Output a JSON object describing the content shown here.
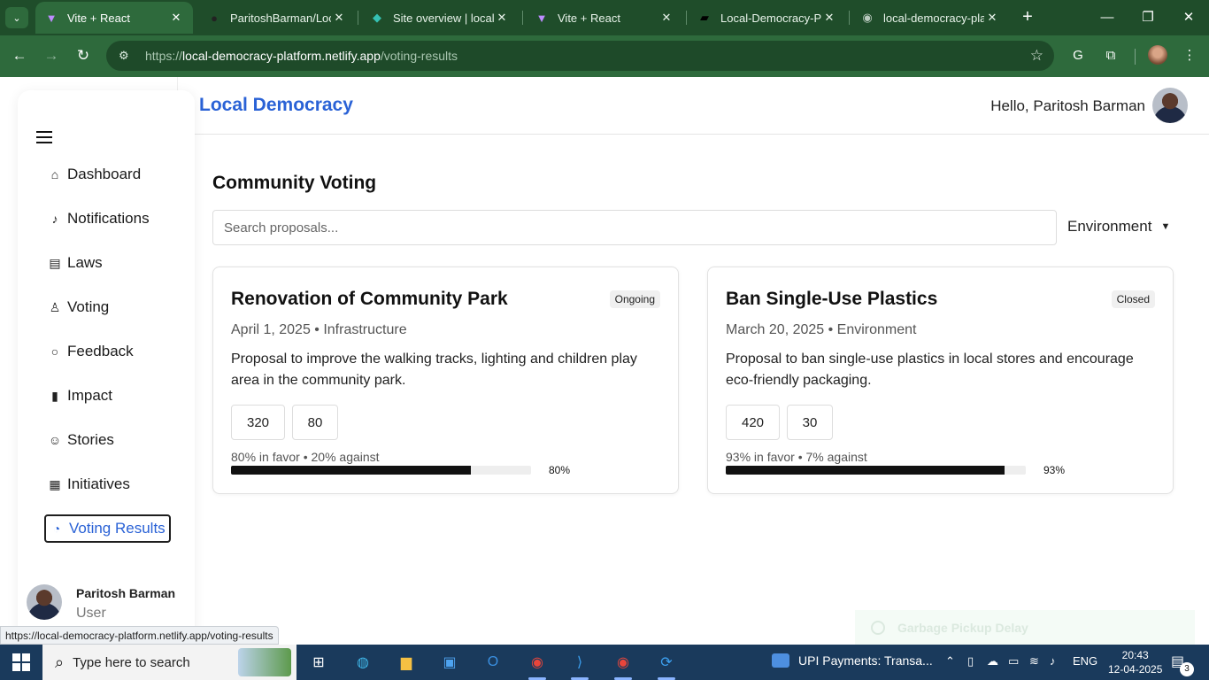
{
  "browser": {
    "tabs": [
      {
        "title": "Vite + React",
        "icon": "vite-icon",
        "active": true
      },
      {
        "title": "ParitoshBarman/Local",
        "icon": "github-icon"
      },
      {
        "title": "Site overview | local-d",
        "icon": "netlify-icon"
      },
      {
        "title": "Vite + React",
        "icon": "vite-icon"
      },
      {
        "title": "Local-Democracy-Pla",
        "icon": "vercel-icon"
      },
      {
        "title": "local-democracy-platf",
        "icon": "globe-icon"
      }
    ],
    "url_scheme": "https://",
    "url_host": "local-democracy-platform.netlify.app",
    "url_path": "/voting-results",
    "status_url": "https://local-democracy-platform.netlify.app/voting-results"
  },
  "header": {
    "brand": "Local Democracy",
    "greeting": "Hello, Paritosh Barman"
  },
  "sidebar": {
    "items": [
      {
        "label": "Dashboard",
        "icon": "home-icon"
      },
      {
        "label": "Notifications",
        "icon": "bell-icon"
      },
      {
        "label": "Laws",
        "icon": "document-icon"
      },
      {
        "label": "Voting",
        "icon": "thumbs-up-icon"
      },
      {
        "label": "Feedback",
        "icon": "message-icon"
      },
      {
        "label": "Impact",
        "icon": "bar-chart-icon"
      },
      {
        "label": "Stories",
        "icon": "users-icon"
      },
      {
        "label": "Initiatives",
        "icon": "calendar-icon"
      },
      {
        "label": "Voting Results",
        "icon": "pie-chart-icon",
        "active": true
      }
    ],
    "user": {
      "name": "Paritosh Barman",
      "role": "User"
    }
  },
  "main": {
    "title": "Community Voting",
    "search_placeholder": "Search proposals...",
    "filter": "Environment",
    "cards": [
      {
        "title": "Renovation of Community Park",
        "status": "Ongoing",
        "meta": "April 1, 2025 • Infrastructure",
        "description": "Proposal to improve the walking tracks, lighting and children play area in the community park.",
        "votes_for": "320",
        "votes_against": "80",
        "stats": "80% in favor • 20% against",
        "percent_label": "80%",
        "percent": 80
      },
      {
        "title": "Ban Single-Use Plastics",
        "status": "Closed",
        "meta": "March 20, 2025 • Environment",
        "description": "Proposal to ban single-use plastics in local stores and encourage eco-friendly packaging.",
        "votes_for": "420",
        "votes_against": "30",
        "stats": "93% in favor • 7% against",
        "percent_label": "93%",
        "percent": 93
      }
    ]
  },
  "toast": {
    "text": "Garbage Pickup Delay"
  },
  "taskbar": {
    "search_placeholder": "Type here to search",
    "notice": "UPI Payments: Transa...",
    "language": "ENG",
    "time": "20:43",
    "date": "12-04-2025",
    "notification_count": "3"
  },
  "colors": {
    "accent": "#2a62d6",
    "chrome": "#1f4d2a",
    "toolbar": "#2e6a3c"
  }
}
